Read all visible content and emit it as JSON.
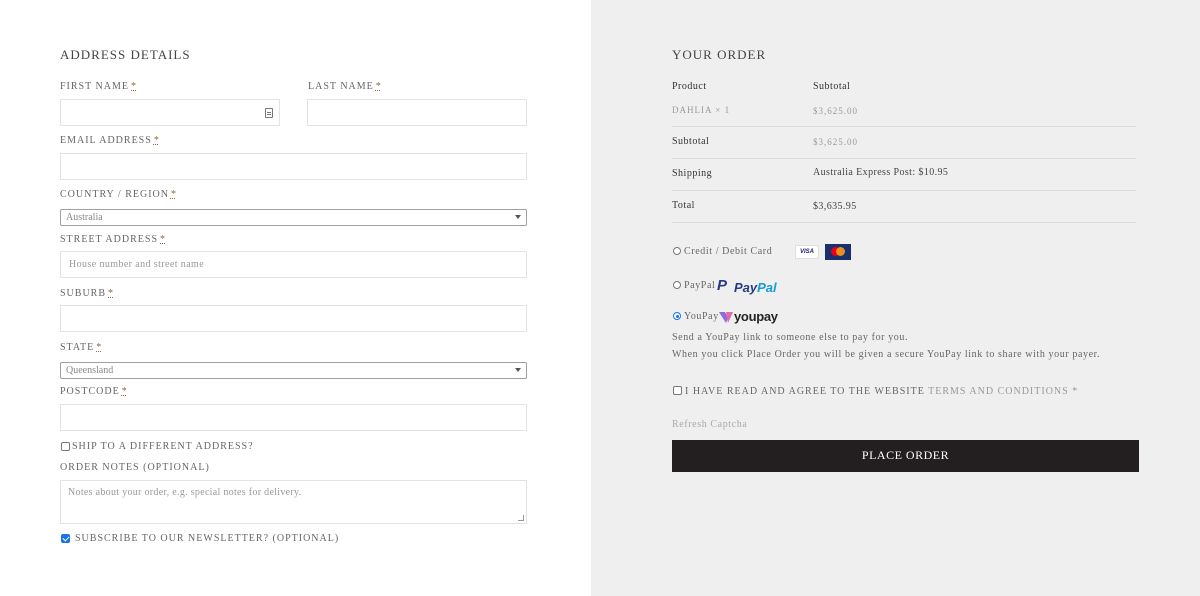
{
  "address": {
    "heading": "ADDRESS DETAILS",
    "first_name_label": "FIRST NAME",
    "last_name_label": "LAST NAME",
    "email_label": "EMAIL ADDRESS",
    "country_label": "COUNTRY / REGION",
    "country_value": "Australia",
    "street_label": "STREET ADDRESS",
    "street_placeholder": "House number and street name",
    "suburb_label": "SUBURB",
    "state_label": "STATE",
    "state_value": "Queensland",
    "postcode_label": "POSTCODE",
    "required_mark": "*",
    "ship_different": "SHIP TO A DIFFERENT ADDRESS?",
    "order_notes_label": "ORDER NOTES (OPTIONAL)",
    "order_notes_placeholder": "Notes about your order, e.g. special notes for delivery.",
    "newsletter_label": "SUBSCRIBE TO OUR NEWSLETTER? (OPTIONAL)",
    "newsletter_checked": true
  },
  "order": {
    "heading": "YOUR ORDER",
    "col_product": "Product",
    "col_subtotal": "Subtotal",
    "item_name": "DAHLIA",
    "item_qty": "× 1",
    "item_price": "$3,625.00",
    "subtotal_label": "Subtotal",
    "subtotal_value": "$3,625.00",
    "shipping_label": "Shipping",
    "shipping_value": "Australia Express Post: $10.95",
    "total_label": "Total",
    "total_value": "$3,635.95"
  },
  "payment": {
    "credit_label": "Credit / Debit Card",
    "visa_text": "VISA",
    "paypal_label": "PayPal",
    "paypal_logo_a": "Pay",
    "paypal_logo_b": "Pal",
    "paypal_mark": "P",
    "youpay_label": "YouPay",
    "youpay_logo": "youpay",
    "youpay_line1": "Send a YouPay link to someone else to pay for you.",
    "youpay_line2": "When you click Place Order you will be given a secure YouPay link to share with your payer.",
    "selected": "YouPay"
  },
  "terms": {
    "prefix": "I HAVE READ AND AGREE TO THE WEBSITE",
    "link": "TERMS AND CONDITIONS",
    "required": "*"
  },
  "captcha": {
    "refresh_label": "Refresh Captcha"
  },
  "place_order_label": "PLACE ORDER",
  "colors": {
    "button_bg": "#231f20",
    "right_panel_bg": "#efeff0",
    "checkbox_accent": "#1a73e8"
  }
}
